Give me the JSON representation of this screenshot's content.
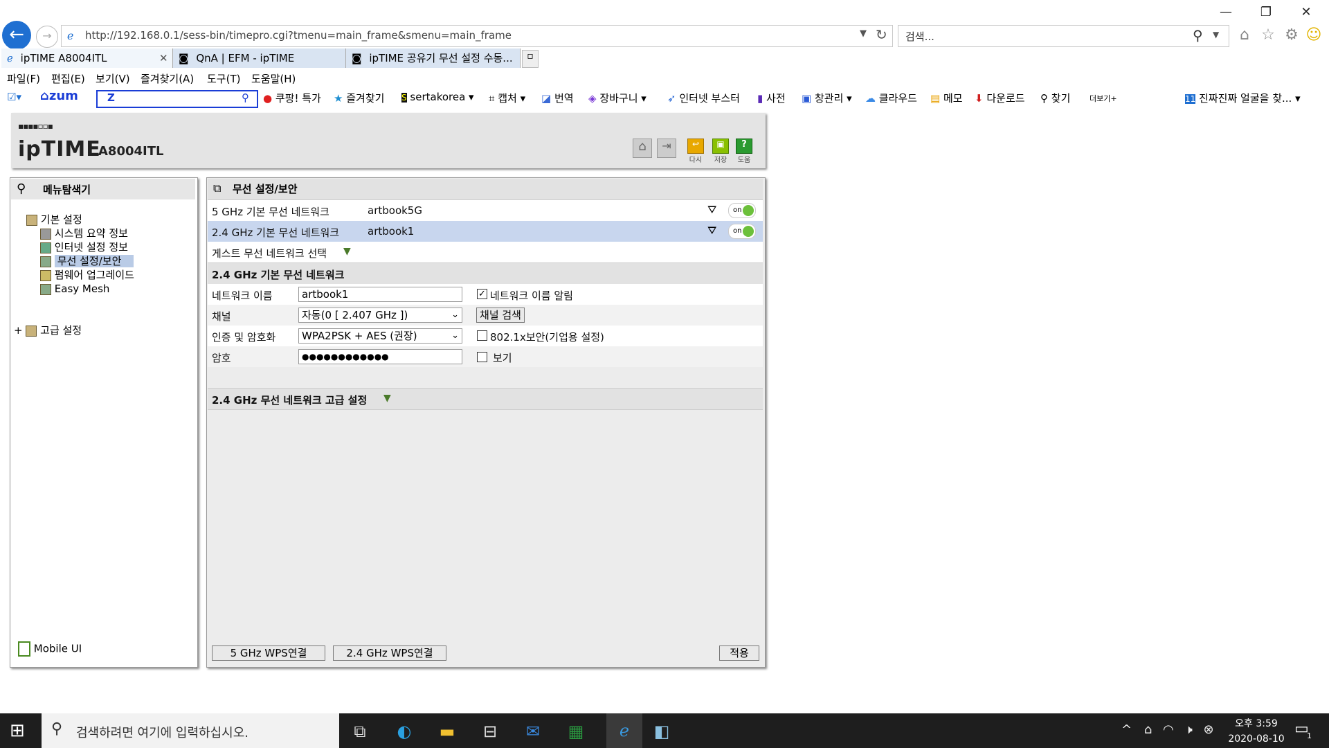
{
  "browser": {
    "url": "http://192.168.0.1/sess-bin/timepro.cgi?tmenu=main_frame&smenu=main_frame",
    "search_placeholder": "검색...",
    "tabs": [
      {
        "label": "ipTIME A8004ITL",
        "active": true
      },
      {
        "label": "QnA | EFM - ipTIME",
        "active": false
      },
      {
        "label": "ipTIME 공유기 무선 설정 수동...",
        "active": false
      }
    ],
    "menu": [
      "파일(F)",
      "편집(E)",
      "보기(V)",
      "즐겨찾기(A)",
      "도구(T)",
      "도움말(H)"
    ],
    "toolbar": {
      "zum_label": "zum",
      "items": [
        "쿠팡! 특가",
        "즐겨찾기",
        "sertakorea",
        "캡처",
        "번역",
        "장바구니",
        "인터넷 부스터",
        "사전",
        "창관리",
        "클라우드",
        "메모",
        "다운로드",
        "찾기",
        "더보기+"
      ],
      "news": "진짜진짜 얼굴을 찾..."
    }
  },
  "router": {
    "brand": "ipTIME",
    "model": "A8004ITL",
    "header_buttons": [
      "다시",
      "저장",
      "도움"
    ],
    "menu_explorer_title": "메뉴탐색기",
    "tree": {
      "basic": "기본 설정",
      "items": [
        "시스템 요약 정보",
        "인터넷 설정 정보",
        "무선 설정/보안",
        "펌웨어 업그레이드",
        "Easy Mesh"
      ],
      "advanced": "고급 설정"
    },
    "mobile_ui": "Mobile UI",
    "main_title": "무선 설정/보안",
    "networks": [
      {
        "label": "5 GHz 기본 무선 네트워크",
        "ssid": "artbook5G",
        "state": "on"
      },
      {
        "label": "2.4 GHz 기본 무선 네트워크",
        "ssid": "artbook1",
        "state": "on"
      }
    ],
    "guest_label": "게스트 무선 네트워크 선택",
    "section_title": "2.4 GHz 기본 무선 네트워크",
    "form": {
      "name_label": "네트워크 이름",
      "name_value": "artbook1",
      "broadcast_label": "네트워크 이름 알림",
      "channel_label": "채널",
      "channel_value": "자동(0 [ 2.407 GHz ])",
      "channel_scan": "채널 검색",
      "auth_label": "인증 및 암호화",
      "auth_value": "WPA2PSK + AES (권장)",
      "enterprise_label": "802.1x보안(기업용 설정)",
      "password_label": "암호",
      "password_value": "●●●●●●●●●●●●",
      "show_label": "보기"
    },
    "advanced_section": "2.4 GHz 무선 네트워크 고급 설정",
    "buttons": {
      "wps5": "5 GHz WPS연결",
      "wps24": "2.4 GHz WPS연결",
      "apply": "적용"
    }
  },
  "taskbar": {
    "search_placeholder": "검색하려면 여기에 입력하십시오.",
    "time": "오후 3:59",
    "date": "2020-08-10",
    "notification_count": "1"
  }
}
